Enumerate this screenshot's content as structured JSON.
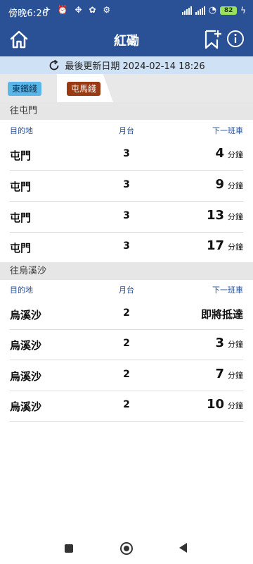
{
  "status_bar": {
    "time": "傍晚6:26",
    "notif_icons": "✈ ⏰ ✥ ✿ ⚙",
    "wifi": "◔",
    "battery": "82",
    "charging": "ϟ"
  },
  "header": {
    "title": "紅磡"
  },
  "update": {
    "label": "最後更新日期 2024-02-14 18:26"
  },
  "tabs": [
    {
      "label": "東鐵綫",
      "color": "#5ab6e8"
    },
    {
      "label": "屯馬綫",
      "color": "#9a3a12"
    }
  ],
  "columns": {
    "destination": "目的地",
    "platform": "月台",
    "next_train": "下一班車"
  },
  "sections": [
    {
      "title": "往屯門",
      "rows": [
        {
          "dest": "屯門",
          "platform": "3",
          "eta": "4",
          "unit": "分鐘"
        },
        {
          "dest": "屯門",
          "platform": "3",
          "eta": "9",
          "unit": "分鐘"
        },
        {
          "dest": "屯門",
          "platform": "3",
          "eta": "13",
          "unit": "分鐘"
        },
        {
          "dest": "屯門",
          "platform": "3",
          "eta": "17",
          "unit": "分鐘"
        }
      ]
    },
    {
      "title": "往烏溪沙",
      "rows": [
        {
          "dest": "烏溪沙",
          "platform": "2",
          "arriving": "即將抵達"
        },
        {
          "dest": "烏溪沙",
          "platform": "2",
          "eta": "3",
          "unit": "分鐘"
        },
        {
          "dest": "烏溪沙",
          "platform": "2",
          "eta": "7",
          "unit": "分鐘"
        },
        {
          "dest": "烏溪沙",
          "platform": "2",
          "eta": "10",
          "unit": "分鐘"
        }
      ]
    }
  ],
  "theme": {
    "primary": "#2a5196",
    "update_bg": "#cfe1f5"
  }
}
